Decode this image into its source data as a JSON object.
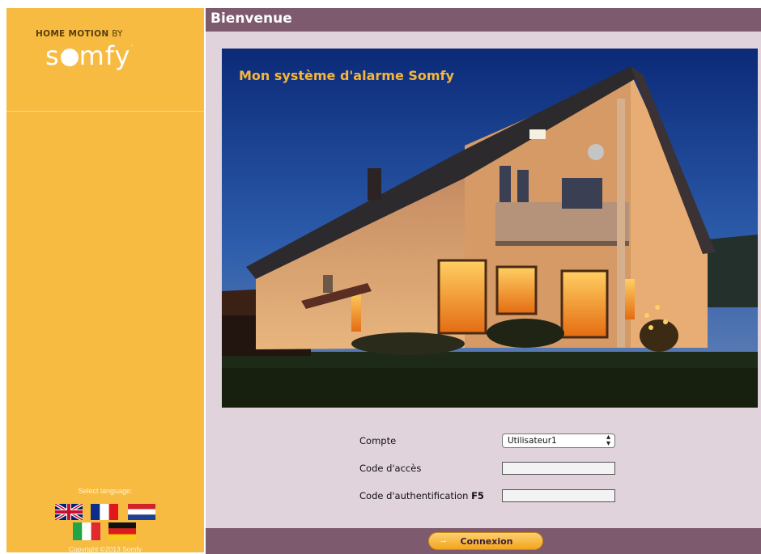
{
  "brand": {
    "tagline_main": "HOME MOTION",
    "tagline_by": " BY",
    "logo_s": "s",
    "logo_rest": "mfy",
    "logo_reg": "."
  },
  "page": {
    "title": "Bienvenue"
  },
  "hero": {
    "title": "Mon système d'alarme Somfy"
  },
  "form": {
    "account_label": "Compte",
    "account_value": "Utilisateur1",
    "access_code_label": "Code d'accès",
    "auth_code_label": "Code d'authentification ",
    "auth_code_key": "F5"
  },
  "actions": {
    "connect_label": "Connexion",
    "connect_arrow": "→"
  },
  "sidebar": {
    "language_label": "Select language:",
    "languages": [
      "English",
      "Français",
      "Nederlands",
      "Italiano",
      "Deutsch"
    ],
    "copyright": "Copyright ©2013 Somfy"
  },
  "colors": {
    "sidebar": "#f7bb41",
    "bar": "#7e5a6e",
    "main_background": "#e1d3db",
    "hero_title": "#f6b63a"
  }
}
